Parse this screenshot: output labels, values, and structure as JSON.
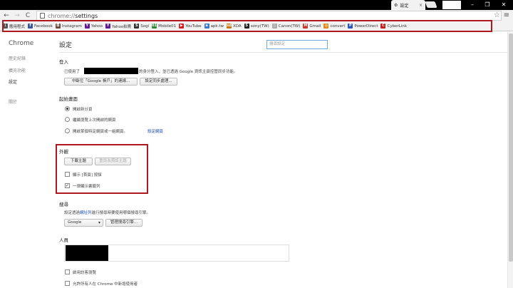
{
  "tab": {
    "title": "設定",
    "close": "×"
  },
  "window": {
    "minimize": "–",
    "maximize": "❐",
    "close": "✕"
  },
  "toolbar": {
    "back": "←",
    "forward": "→",
    "reload": "C",
    "url_scheme": "chrome://",
    "url_path": "settings",
    "star": "☆",
    "menu": "≡"
  },
  "bookmarks": [
    {
      "label": "應用程式",
      "icon": "apps-icon",
      "color": "#555555",
      "glyph": "⋮"
    },
    {
      "label": "Facebook",
      "icon": "facebook-icon",
      "color": "#3b5998",
      "glyph": "f"
    },
    {
      "label": "Instagram",
      "icon": "instagram-icon",
      "color": "#6a4a3a",
      "glyph": "◘"
    },
    {
      "label": "Yahoo",
      "icon": "yahoo-icon",
      "color": "#5f1a9c",
      "glyph": "Y"
    },
    {
      "label": "Yahoo拍賣",
      "icon": "yahoo-auction-icon",
      "color": "#5f1a9c",
      "glyph": "Y"
    },
    {
      "label": "Sogi",
      "icon": "sogi-icon",
      "color": "#333333",
      "glyph": "S"
    },
    {
      "label": "Mobile01",
      "icon": "mobile01-icon",
      "color": "#2e8b3a",
      "glyph": "01"
    },
    {
      "label": "YouTube",
      "icon": "youtube-icon",
      "color": "#d41f1f",
      "glyph": "▶"
    },
    {
      "label": "apk.tw",
      "icon": "apk-icon",
      "color": "#3a78c9",
      "glyph": "a"
    },
    {
      "label": "XDA",
      "icon": "xda-icon",
      "color": "#c77a12",
      "glyph": "xda"
    },
    {
      "label": "sony(TW)",
      "icon": "sony-icon",
      "color": "#222222",
      "glyph": "S"
    },
    {
      "label": "Canon(TW)",
      "icon": "canon-icon",
      "color": "#aaaaaa",
      "glyph": "▯"
    },
    {
      "label": "Gmail",
      "icon": "gmail-icon",
      "color": "#c53929",
      "glyph": "M"
    },
    {
      "label": "convert",
      "icon": "convert-icon",
      "color": "#e08a1e",
      "glyph": "◎"
    },
    {
      "label": "PowerDirect",
      "icon": "powerdirect-icon",
      "color": "#2a58b8",
      "glyph": "P"
    },
    {
      "label": "CyberLink",
      "icon": "cyberlink-icon",
      "color": "#c41b1b",
      "glyph": "C"
    }
  ],
  "sidebar": {
    "brand": "Chrome",
    "items": [
      {
        "label": "歷史紀錄",
        "active": false
      },
      {
        "label": "擴充功能",
        "active": false
      },
      {
        "label": "設定",
        "active": true
      },
      {
        "label": "關於",
        "active": false
      }
    ]
  },
  "main": {
    "title": "設定",
    "search_placeholder": "搜尋設定",
    "signin": {
      "title": "登入",
      "text_prefix": "已使用了",
      "text_suffix": "的身分登入，並已透過 Google 資訊主頁控管同步功能。",
      "disconnect_btn": "中斷位「Google 帳戶」的連線...",
      "sync_btn": "設定同步處理..."
    },
    "startup": {
      "title": "起始畫面",
      "options": [
        {
          "label": "開啟新分頁",
          "selected": true
        },
        {
          "label": "繼續瀏覽上次開啟的網頁",
          "selected": false
        },
        {
          "label": "開啟某個特定網頁或一組網頁。",
          "selected": false
        }
      ],
      "set_pages_link": "設定網頁"
    },
    "appearance": {
      "title": "外觀",
      "get_themes_btn": "下載主題",
      "reset_theme_btn": "重設為預設主題",
      "home_button_label": "顯示 [首頁] 按鈕",
      "home_button_checked": false,
      "bookmarks_bar_label": "一律顯示書籤列",
      "bookmarks_bar_checked": true
    },
    "search_engine": {
      "title": "搜尋",
      "text_prefix": "設定透過",
      "link": "網址列",
      "text_suffix": "進行搜尋時要使用哪個搜尋引擎。",
      "selected": "Google",
      "manage_btn": "管理搜尋引擎..."
    },
    "people": {
      "title": "人員",
      "guest_label": "啟用訪客瀏覽",
      "guest_checked": false,
      "add_person_label": "允許所有人在 Chrome 中新增使用者",
      "add_person_checked": false
    }
  }
}
